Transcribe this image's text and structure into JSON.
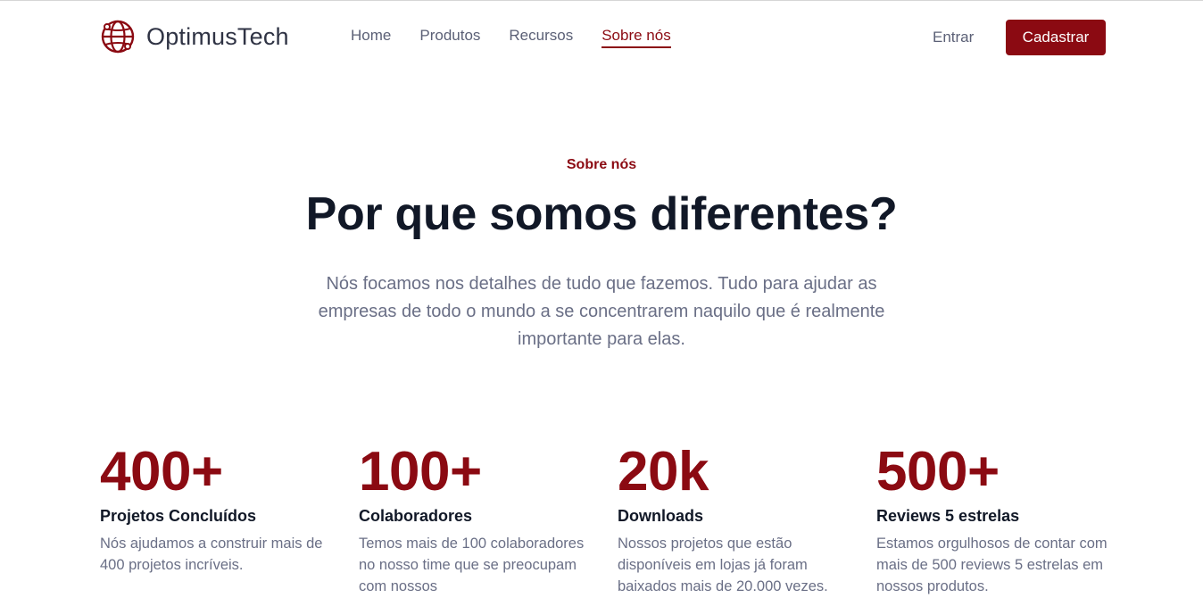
{
  "header": {
    "brand": "OptimusTech",
    "nav": [
      {
        "label": "Home",
        "active": false
      },
      {
        "label": "Produtos",
        "active": false
      },
      {
        "label": "Recursos",
        "active": false
      },
      {
        "label": "Sobre nós",
        "active": true
      }
    ],
    "login_label": "Entrar",
    "signup_label": "Cadastrar"
  },
  "hero": {
    "eyebrow": "Sobre nós",
    "title": "Por que somos diferentes?",
    "description": "Nós focamos nos detalhes de tudo que fazemos. Tudo para ajudar as empresas de todo o mundo a se concentrarem naquilo que é realmente importante para elas."
  },
  "stats": [
    {
      "value": "400+",
      "title": "Projetos Concluídos",
      "description": "Nós ajudamos a construir mais de 400 projetos incríveis."
    },
    {
      "value": "100+",
      "title": "Colaboradores",
      "description": "Temos mais de 100 colaboradores no nosso time que se preocupam com nossos"
    },
    {
      "value": "20k",
      "title": "Downloads",
      "description": "Nossos projetos que estão disponíveis em lojas já foram baixados mais de 20.000 vezes."
    },
    {
      "value": "500+",
      "title": "Reviews 5 estrelas",
      "description": "Estamos orgulhosos de contar com mais de 500 reviews 5 estrelas em nossos produtos."
    }
  ],
  "icons": {
    "logo": "globe-network-icon"
  },
  "colors": {
    "accent": "#8b0a12",
    "text": "#111827",
    "muted": "#6a6f86"
  }
}
